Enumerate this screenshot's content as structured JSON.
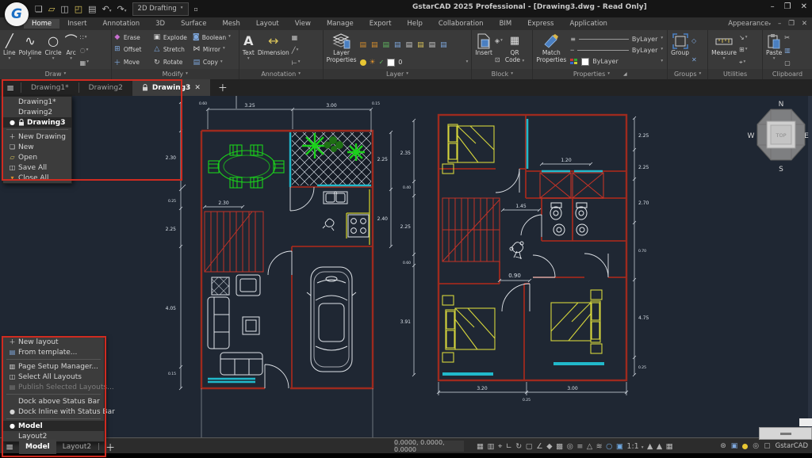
{
  "window": {
    "title": "GstarCAD 2025 Professional - [Drawing3.dwg - Read Only]",
    "workspace": "2D Drafting",
    "appearance": "Appearance",
    "logo": "G"
  },
  "menu": {
    "tabs": [
      "Home",
      "Insert",
      "Annotation",
      "3D",
      "Surface",
      "Mesh",
      "Layout",
      "View",
      "Manage",
      "Export",
      "Help",
      "Collaboration",
      "BIM",
      "Express",
      "Application"
    ]
  },
  "ribbon": {
    "draw": {
      "label": "Draw",
      "items": [
        "Line",
        "Polyline",
        "Circle",
        "Arc"
      ]
    },
    "modify": {
      "label": "Modify",
      "items": [
        "Erase",
        "Explode",
        "Boolean",
        "Offset",
        "Stretch",
        "Mirror",
        "Move",
        "Rotate",
        "Copy"
      ]
    },
    "annotation": {
      "label": "Annotation",
      "text": "Text",
      "dimension": "Dimension"
    },
    "layer": {
      "label": "Layer",
      "properties_1": "Layer",
      "properties_2": "Properties",
      "current": "0"
    },
    "block": {
      "label": "Block",
      "insert": "Insert",
      "qr_1": "QR",
      "qr_2": "Code"
    },
    "properties": {
      "label": "Properties",
      "match_1": "Match",
      "match_2": "Properties",
      "bylayer": "ByLayer"
    },
    "groups": {
      "label": "Groups",
      "group": "Group"
    },
    "utilities": {
      "label": "Utilities",
      "measure": "Measure"
    },
    "clipboard": {
      "label": "Clipboard",
      "paste": "Paste"
    }
  },
  "doc_tabs": {
    "t1": "Drawing1*",
    "t2": "Drawing2",
    "t3": "Drawing3"
  },
  "tab_menu": {
    "i1": "Drawing1*",
    "i2": "Drawing2",
    "i3": "Drawing3",
    "new_drawing": "New Drawing",
    "new_file": "New",
    "open": "Open",
    "save_all": "Save All",
    "close_all": "Close All"
  },
  "layout_menu": {
    "new_layout": "New layout",
    "from_template": "From template...",
    "page_setup": "Page Setup Manager...",
    "select_all": "Select All Layouts",
    "publish": "Publish Selected Layouts...",
    "dock_above": "Dock above Status Bar",
    "dock_inline": "Dock Inline with Status Bar",
    "model": "Model",
    "layout2": "Layout2"
  },
  "layout_tabs": {
    "model": "Model",
    "layout2": "Layout2"
  },
  "status": {
    "coords": "0.0000, 0.0000, 0.0000",
    "scale": "1:1",
    "brand": "GstarCAD"
  },
  "viewcube": {
    "n": "N",
    "e": "E",
    "s": "S",
    "w": "W",
    "top": "TOP"
  },
  "plan": {
    "dims": {
      "top_l": "0.60",
      "top_a": "3.25",
      "top_b": "3.00",
      "top_r": "0.15",
      "stairs": "2.30",
      "l1": "2.30",
      "l2": "0.25",
      "l3": "2.25",
      "l4": "4.05",
      "l5": "0.15",
      "ma1": "2.25",
      "ma2": "2.40",
      "mb1": "2.35",
      "mb2": "0.40",
      "mb3": "2.25",
      "mb4": "0.60",
      "mb5": "3.91",
      "r120": "1.20",
      "r145": "1.45",
      "r090": "0.90",
      "b1": "3.20",
      "b2": "3.00",
      "b3": "0.25",
      "rt1": "2.25",
      "rt2": "2.25",
      "rt3": "2.70",
      "rt4": "0.70",
      "rt5": "4.75",
      "rt6": "0.25"
    }
  },
  "colors": {
    "wall_red": "#9e2a1e",
    "highlight_red": "#cf2b20",
    "bed_yellow": "#d6d63c",
    "plant_green": "#1bd11b",
    "window_cyan": "#21b9cb",
    "dim_white": "#d9e0e8",
    "canvas_bg": "#1f2733"
  }
}
